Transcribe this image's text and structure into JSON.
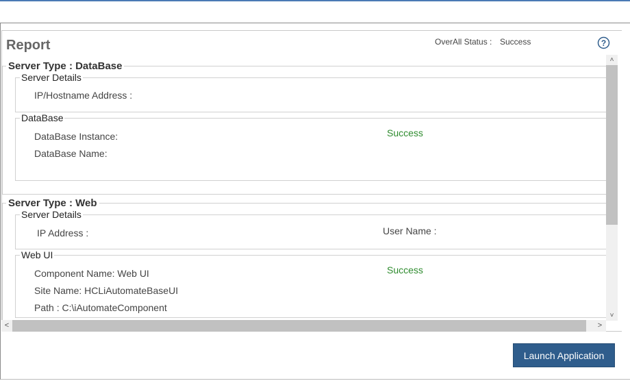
{
  "report": {
    "title": "Report",
    "overall_status_label": "OverAll Status :",
    "overall_status_value": "Success"
  },
  "icons": {
    "help": "help-circle-icon",
    "scroll_up": "chevron-up-icon",
    "scroll_down": "chevron-down-icon",
    "scroll_left": "chevron-left-icon",
    "scroll_right": "chevron-right-icon"
  },
  "sections": {
    "database": {
      "title": "Server Type : DataBase",
      "server_details": {
        "title": "Server Details",
        "ip_label": "IP/Hostname Address :"
      },
      "database": {
        "title": "DataBase",
        "instance_label": "DataBase Instance:",
        "name_label": "DataBase Name:",
        "status": "Success"
      }
    },
    "web": {
      "title": "Server Type : Web",
      "server_details": {
        "title": "Server Details",
        "ip_label": "IP Address :",
        "user_label": "User Name :"
      },
      "web_ui": {
        "title": "Web UI",
        "component_name": "Component Name: Web UI",
        "site_name": "Site Name: HCLiAutomateBaseUI",
        "path": "Path : C:\\iAutomateComponent",
        "status": "Success"
      }
    }
  },
  "actions": {
    "launch_label": "Launch Application"
  },
  "colors": {
    "accent": "#2f5d8c",
    "success": "#2e8b2e"
  }
}
